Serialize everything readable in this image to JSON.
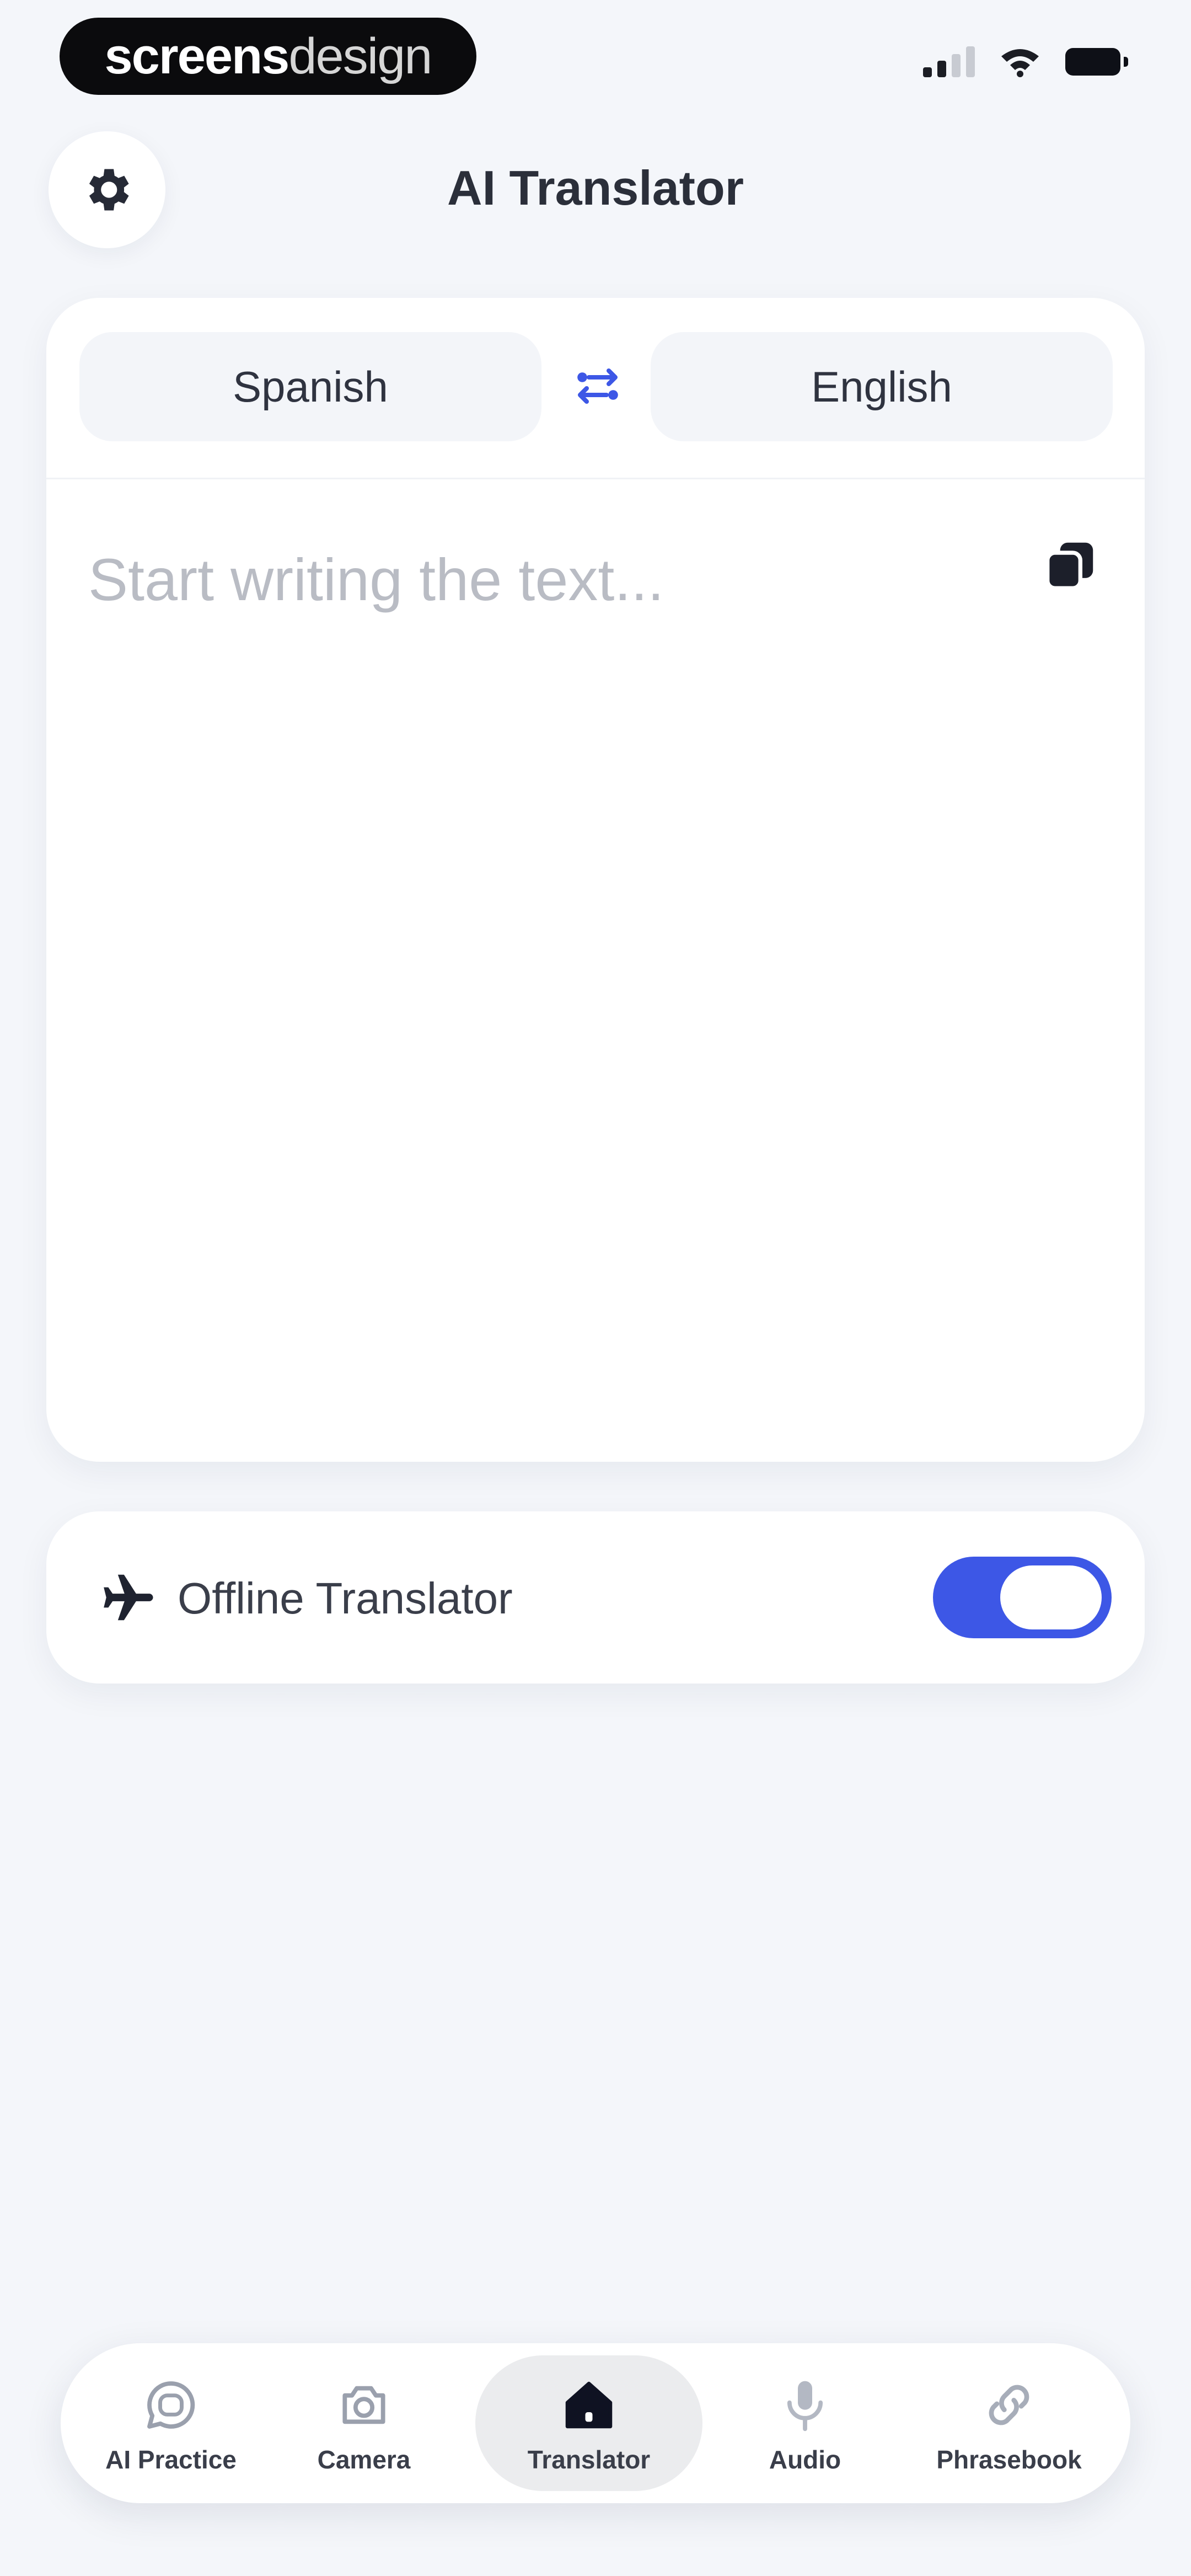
{
  "status_bar": {
    "brand_bold": "screens",
    "brand_light": "design"
  },
  "header": {
    "title": "AI Translator",
    "settings_icon": "gear-icon"
  },
  "translator": {
    "source_language": "Spanish",
    "target_language": "English",
    "swap_icon": "swap-arrows-icon",
    "input_placeholder": "Start writing the text...",
    "input_value": "",
    "copy_icon": "copy-icon"
  },
  "offline": {
    "label": "Offline Translator",
    "icon": "airplane-icon",
    "enabled": true
  },
  "tabs": [
    {
      "label": "AI Practice",
      "icon": "chat-bubble-icon",
      "active": false
    },
    {
      "label": "Camera",
      "icon": "camera-icon",
      "active": false
    },
    {
      "label": "Translator",
      "icon": "home-icon",
      "active": true
    },
    {
      "label": "Audio",
      "icon": "microphone-icon",
      "active": false
    },
    {
      "label": "Phrasebook",
      "icon": "link-icon",
      "active": false
    }
  ],
  "colors": {
    "accent": "#3d57e6",
    "background": "#f4f6fa",
    "card": "#ffffff",
    "text": "#2b2f3a"
  }
}
